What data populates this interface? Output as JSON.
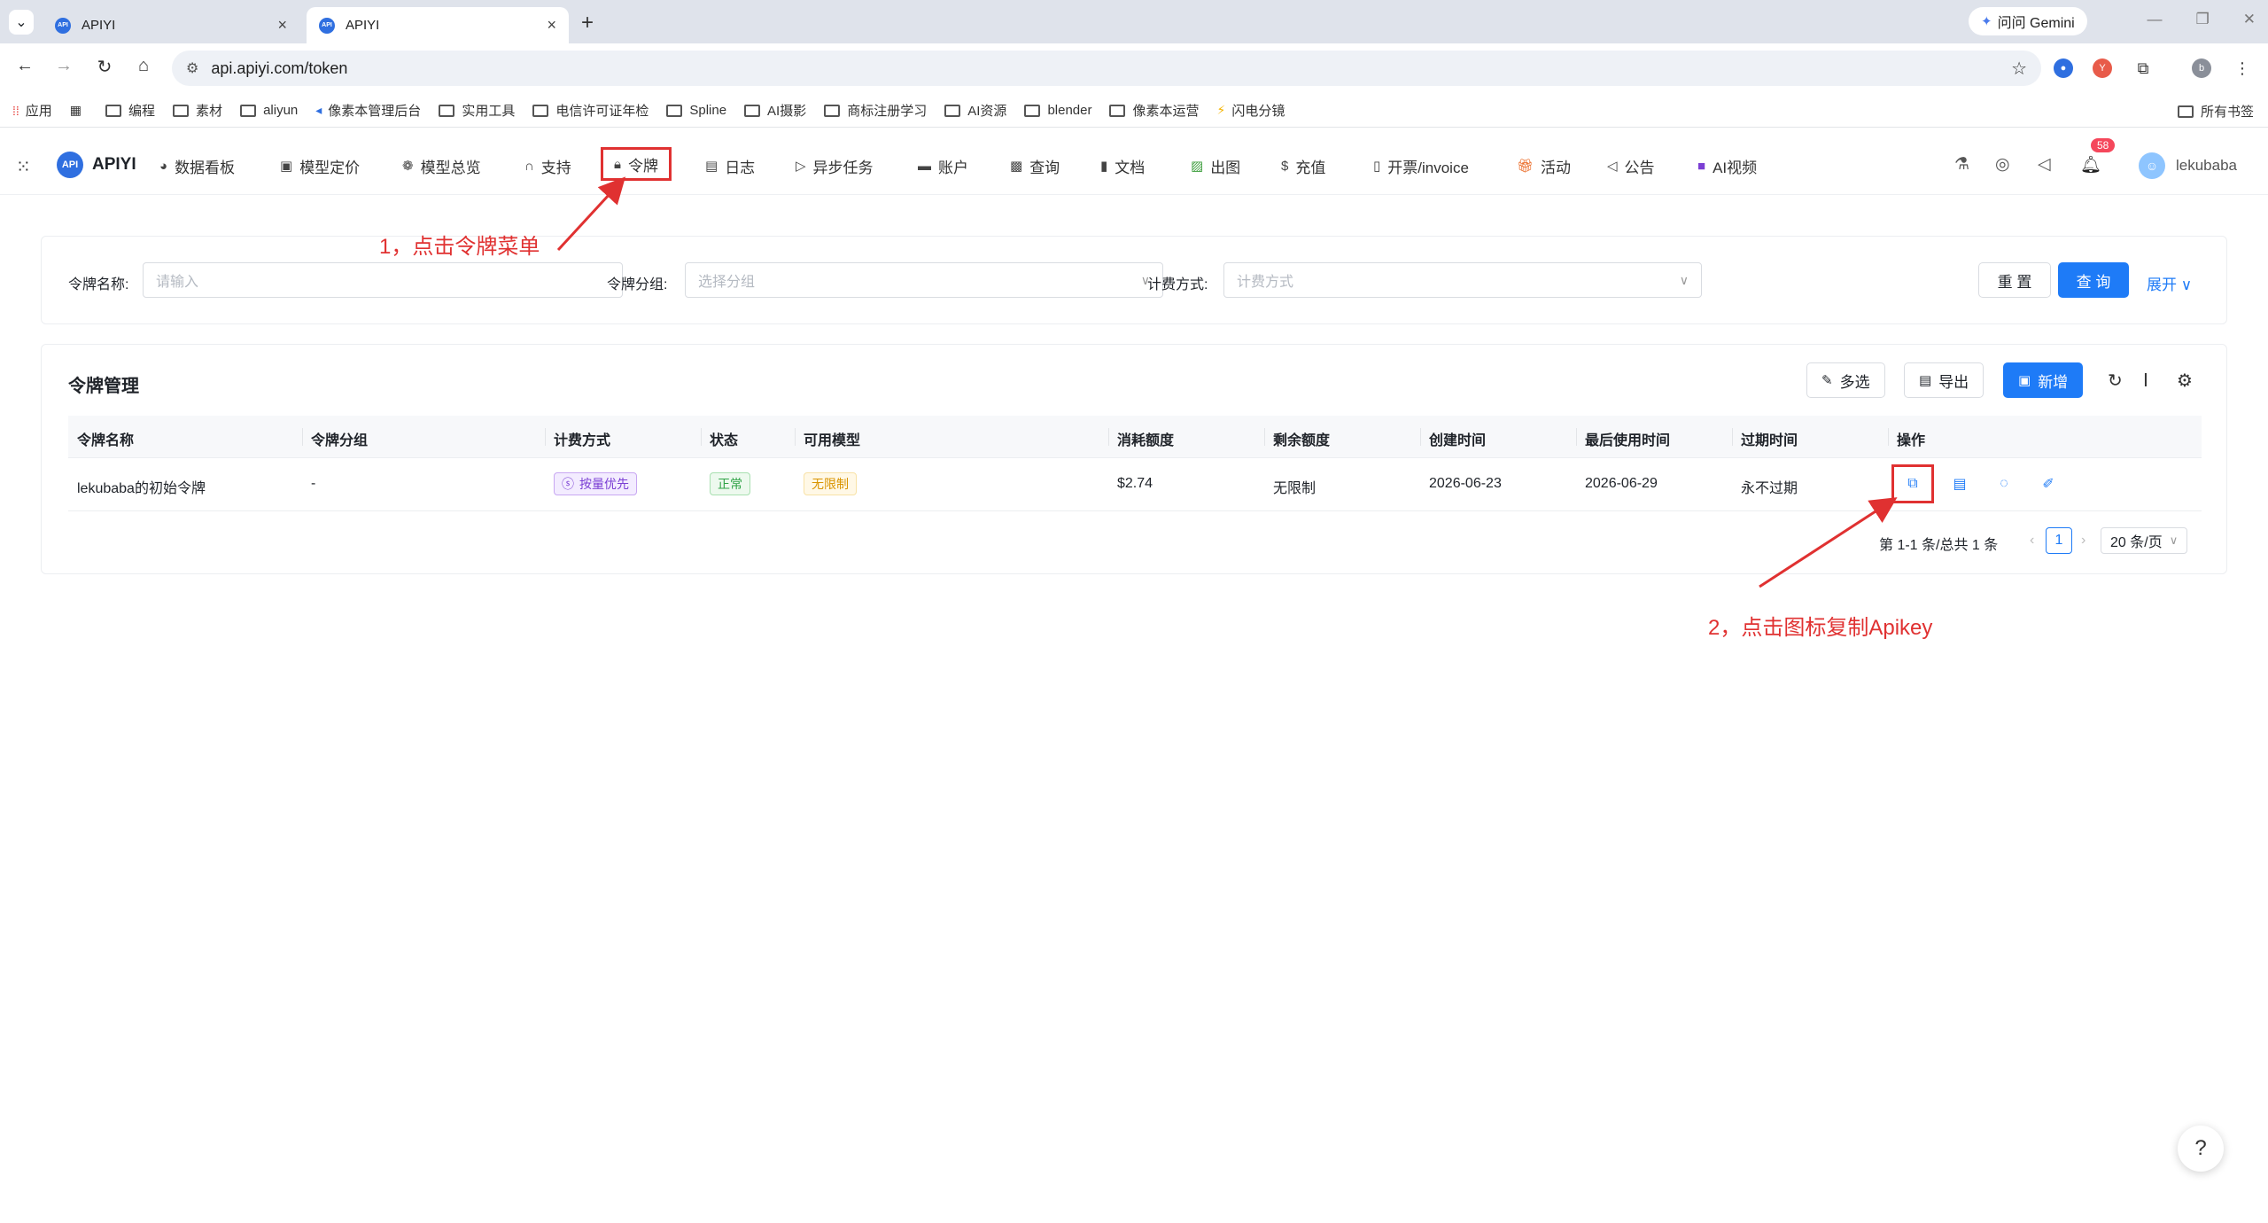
{
  "browser": {
    "tabs": [
      {
        "favicon_text": "API",
        "title": "APIYI"
      },
      {
        "favicon_text": "API",
        "title": "APIYI"
      }
    ],
    "gemini_label": "问问 Gemini",
    "url": "api.apiyi.com/token",
    "profile_initial": "b",
    "bookmarks": [
      "应用",
      "编程",
      "素材",
      "aliyun",
      "像素本管理后台",
      "实用工具",
      "电信许可证年检",
      "Spline",
      "AI摄影",
      "商标注册学习",
      "AI资源",
      "blender",
      "像素本运营",
      "闪电分镜"
    ],
    "all_bookmarks": "所有书签"
  },
  "app": {
    "logo_text": "API",
    "brand": "APIYI",
    "nav": [
      {
        "label": "数据看板",
        "icon": "dashboard-icon"
      },
      {
        "label": "模型定价",
        "icon": "pricing-icon"
      },
      {
        "label": "模型总览",
        "icon": "models-icon"
      },
      {
        "label": "支持",
        "icon": "headset-icon"
      },
      {
        "label": "令牌",
        "icon": "lock-icon"
      },
      {
        "label": "日志",
        "icon": "log-icon"
      },
      {
        "label": "异步任务",
        "icon": "async-icon"
      },
      {
        "label": "账户",
        "icon": "account-icon"
      },
      {
        "label": "查询",
        "icon": "query-icon"
      },
      {
        "label": "文档",
        "icon": "doc-icon"
      },
      {
        "label": "出图",
        "icon": "image-icon"
      },
      {
        "label": "充值",
        "icon": "recharge-icon"
      },
      {
        "label": "开票/invoice",
        "icon": "invoice-icon"
      },
      {
        "label": "活动",
        "icon": "gift-icon"
      },
      {
        "label": "公告",
        "icon": "announce-icon"
      },
      {
        "label": "AI视频",
        "icon": "video-icon"
      }
    ],
    "notification_count": "58",
    "username": "lekubaba"
  },
  "filters": {
    "name_label": "令牌名称:",
    "name_placeholder": "请输入",
    "group_label": "令牌分组:",
    "group_placeholder": "选择分组",
    "billing_label": "计费方式:",
    "billing_placeholder": "计费方式",
    "reset": "重 置",
    "search": "查 询",
    "expand": "展开"
  },
  "table": {
    "title": "令牌管理",
    "toolbar": {
      "multi": "多选",
      "export": "导出",
      "add": "新增"
    },
    "columns": [
      "令牌名称",
      "令牌分组",
      "计费方式",
      "状态",
      "可用模型",
      "消耗额度",
      "剩余额度",
      "创建时间",
      "最后使用时间",
      "过期时间",
      "操作"
    ],
    "rows": [
      {
        "name": "lekubaba的初始令牌",
        "group": "-",
        "billing": "按量优先",
        "status": "正常",
        "models": "无限制",
        "used": "$2.74",
        "remaining": "无限制",
        "created": "2026-06-23",
        "last_used": "2026-06-29",
        "expires": "永不过期"
      }
    ],
    "pagination": {
      "summary": "第 1-1 条/总共 1 条",
      "current": "1",
      "page_size": "20 条/页"
    }
  },
  "annotations": {
    "step1": "1，点击令牌菜单",
    "step2": "2，点击图标复制Apikey",
    "color": "#e03131"
  },
  "help": "?"
}
